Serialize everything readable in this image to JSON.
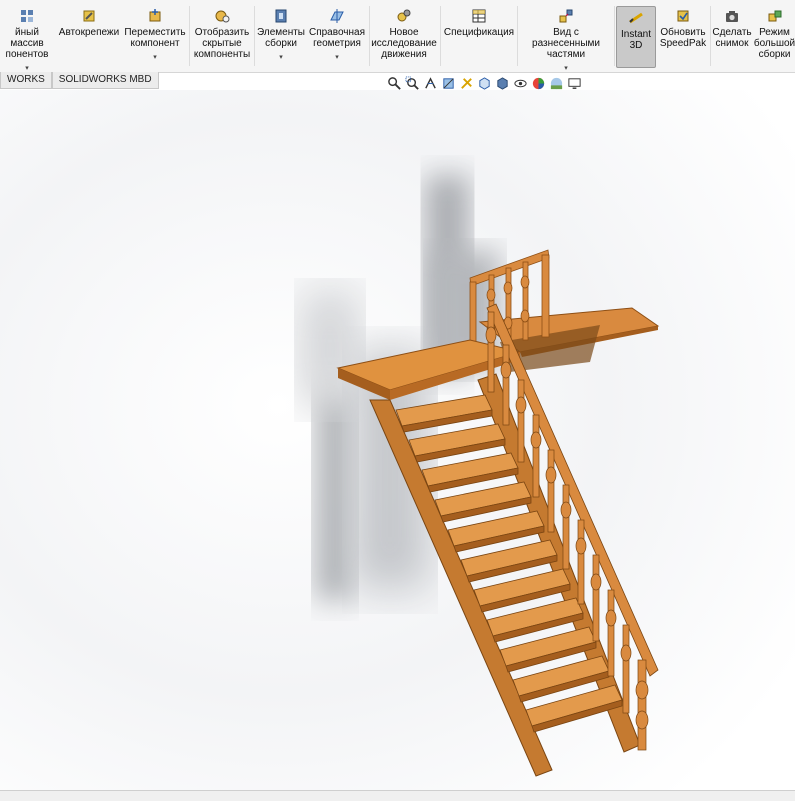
{
  "ribbon": {
    "pattern": {
      "line1": "йный массив",
      "line2": "понентов"
    },
    "autofasteners": {
      "line1": "Автокрепежи"
    },
    "move": {
      "line1": "Переместить",
      "line2": "компонент"
    },
    "show_hidden": {
      "line1": "Отобразить",
      "line2": "скрытые",
      "line3": "компоненты"
    },
    "assembly_features": {
      "line1": "Элементы",
      "line2": "сборки"
    },
    "ref_geometry": {
      "line1": "Справочная",
      "line2": "геометрия"
    },
    "new_motion": {
      "line1": "Новое",
      "line2": "исследование",
      "line3": "движения"
    },
    "bom": {
      "line1": "Спецификация"
    },
    "exploded": {
      "line1": "Вид с разнесенными",
      "line2": "частями"
    },
    "instant3d": {
      "line1": "Instant",
      "line2": "3D"
    },
    "speedpak": {
      "line1": "Обновить",
      "line2": "SpeedPak"
    },
    "snapshot": {
      "line1": "Сделать",
      "line2": "снимок"
    },
    "large_assembly": {
      "line1": "Режим",
      "line2": "большой",
      "line3": "сборки"
    },
    "dropdown_glyph": "▾"
  },
  "tabs": [
    "WORKS",
    "SOLIDWORKS MBD"
  ],
  "view_toolbar": {
    "icons": [
      "zoom-to-fit-icon",
      "zoom-area-icon",
      "previous-view-icon",
      "section-view-icon",
      "dynamic-annotation-icon",
      "view-orientation-icon",
      "display-style-icon",
      "hide-show-items-icon",
      "edit-appearance-icon",
      "apply-scene-icon",
      "view-settings-icon"
    ]
  },
  "colors": {
    "wood": "#d98a3f",
    "wood_dark": "#a55e1e",
    "wood_light": "#f0ab5e",
    "active_button": "#c9c9c9"
  }
}
